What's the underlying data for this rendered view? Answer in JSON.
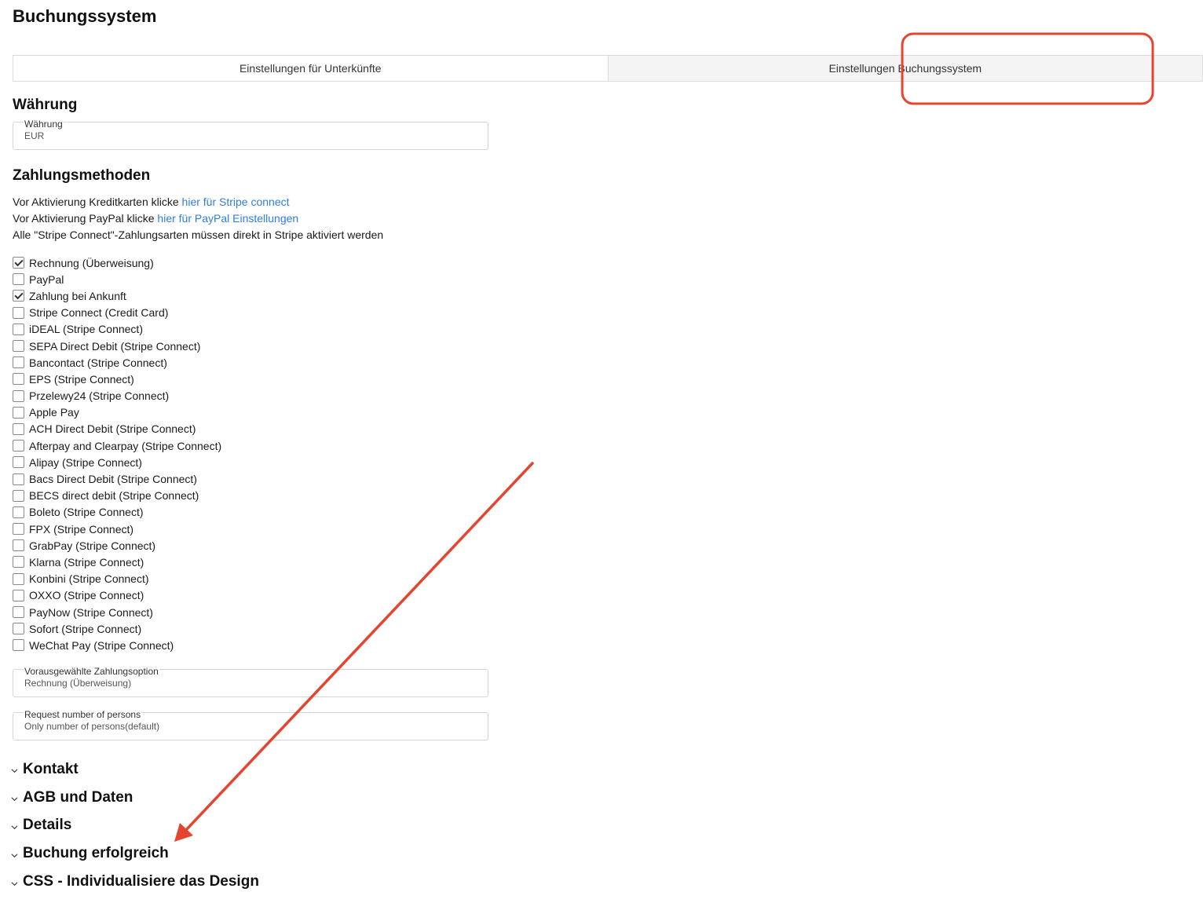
{
  "page_title": "Buchungssystem",
  "tabs": [
    {
      "label": "Einstellungen für Unterkünfte",
      "active": false
    },
    {
      "label": "Einstellungen Buchungssystem",
      "active": true
    }
  ],
  "currency_section": {
    "title": "Währung",
    "field": {
      "label": "Währung",
      "value": "EUR"
    }
  },
  "payment_section": {
    "title": "Zahlungsmethoden",
    "info": [
      {
        "text": "Vor Aktivierung Kreditkarten klicke ",
        "link": "hier für Stripe connect"
      },
      {
        "text": "Vor Aktivierung PayPal klicke ",
        "link": "hier für PayPal Einstellungen"
      },
      {
        "text": "Alle \"Stripe Connect\"-Zahlungsarten müssen direkt in Stripe aktiviert werden",
        "link": ""
      }
    ],
    "methods": [
      {
        "label": "Rechnung (Überweisung)",
        "checked": true
      },
      {
        "label": "PayPal",
        "checked": false
      },
      {
        "label": "Zahlung bei Ankunft",
        "checked": true
      },
      {
        "label": "Stripe Connect (Credit Card)",
        "checked": false
      },
      {
        "label": "iDEAL (Stripe Connect)",
        "checked": false
      },
      {
        "label": "SEPA Direct Debit (Stripe Connect)",
        "checked": false
      },
      {
        "label": "Bancontact (Stripe Connect)",
        "checked": false
      },
      {
        "label": "EPS (Stripe Connect)",
        "checked": false
      },
      {
        "label": "Przelewy24 (Stripe Connect)",
        "checked": false
      },
      {
        "label": "Apple Pay",
        "checked": false
      },
      {
        "label": "ACH Direct Debit (Stripe Connect)",
        "checked": false
      },
      {
        "label": "Afterpay and Clearpay (Stripe Connect)",
        "checked": false
      },
      {
        "label": "Alipay (Stripe Connect)",
        "checked": false
      },
      {
        "label": "Bacs Direct Debit (Stripe Connect)",
        "checked": false
      },
      {
        "label": "BECS direct debit (Stripe Connect)",
        "checked": false
      },
      {
        "label": "Boleto (Stripe Connect)",
        "checked": false
      },
      {
        "label": "FPX (Stripe Connect)",
        "checked": false
      },
      {
        "label": "GrabPay (Stripe Connect)",
        "checked": false
      },
      {
        "label": "Klarna (Stripe Connect)",
        "checked": false
      },
      {
        "label": "Konbini (Stripe Connect)",
        "checked": false
      },
      {
        "label": "OXXO (Stripe Connect)",
        "checked": false
      },
      {
        "label": "PayNow (Stripe Connect)",
        "checked": false
      },
      {
        "label": "Sofort (Stripe Connect)",
        "checked": false
      },
      {
        "label": "WeChat Pay (Stripe Connect)",
        "checked": false
      }
    ],
    "preselected": {
      "label": "Vorausgewählte Zahlungsoption",
      "value": "Rechnung (Überweisung)"
    },
    "persons": {
      "label": "Request number of persons",
      "value": "Only number of persons(default)"
    }
  },
  "accordion": [
    "Kontakt",
    "AGB und Daten",
    "Details",
    "Buchung erfolgreich",
    "CSS - Individualisiere das Design"
  ],
  "colors": {
    "annotation": "#e5442f",
    "link": "#2f7de1"
  },
  "icons": {
    "checkbox_checked": "checkmark-icon",
    "accordion": "chevron-down-icon"
  }
}
